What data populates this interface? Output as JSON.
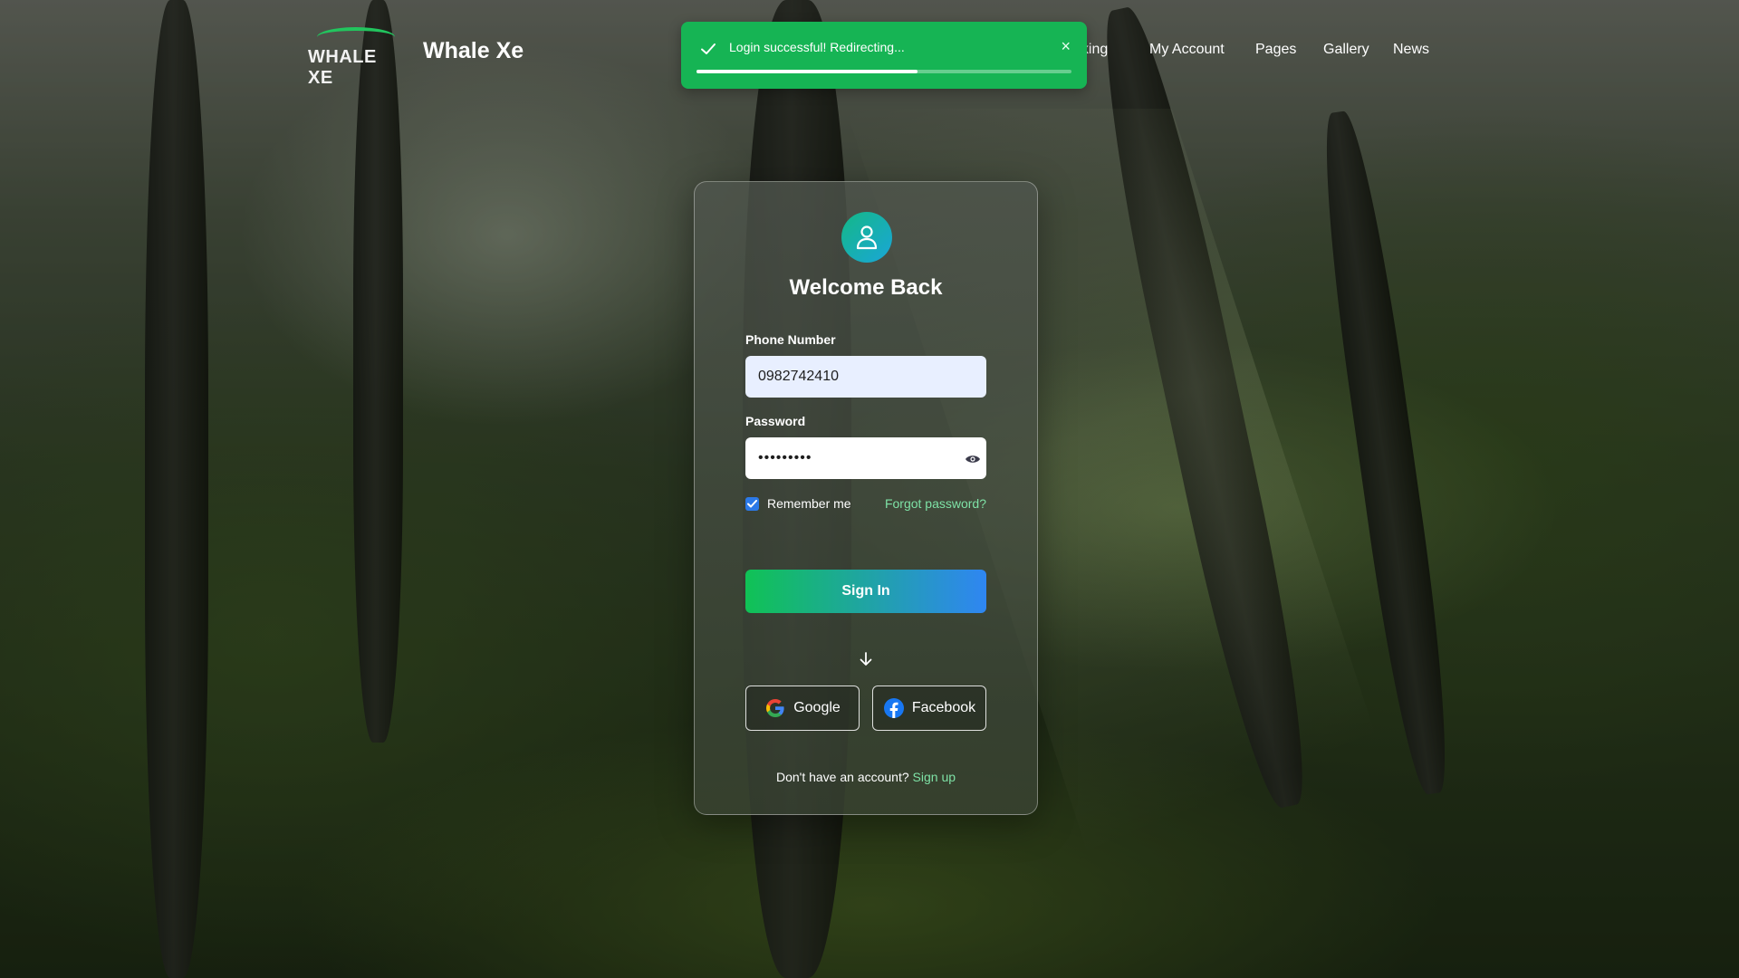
{
  "brand": {
    "logo_text": "WHALE XE",
    "name": "Whale Xe",
    "accent": "#22c55e"
  },
  "nav": {
    "items": [
      {
        "label": "oking"
      },
      {
        "label": "My Account"
      },
      {
        "label": "Pages"
      },
      {
        "label": "Gallery"
      },
      {
        "label": "News"
      }
    ]
  },
  "toast": {
    "message": "Login successful! Redirecting...",
    "icon": "check-icon",
    "close_icon": "close-icon",
    "close_glyph": "×",
    "progress": 0.59,
    "color": "#16b454"
  },
  "login": {
    "avatar_icon": "user-icon",
    "title": "Welcome Back",
    "phone_label": "Phone Number",
    "phone_value": "0982742410",
    "password_label": "Password",
    "password_value": "•••••••••",
    "password_toggle_icon": "eye-icon",
    "remember_label": "Remember me",
    "remember_checked": true,
    "forgot_label": "Forgot password?",
    "submit_label": "Sign In",
    "divider_icon": "arrow-down-icon",
    "google_label": "Google",
    "facebook_label": "Facebook",
    "signup_prompt": "Don't have an account?",
    "signup_link": "Sign up"
  }
}
